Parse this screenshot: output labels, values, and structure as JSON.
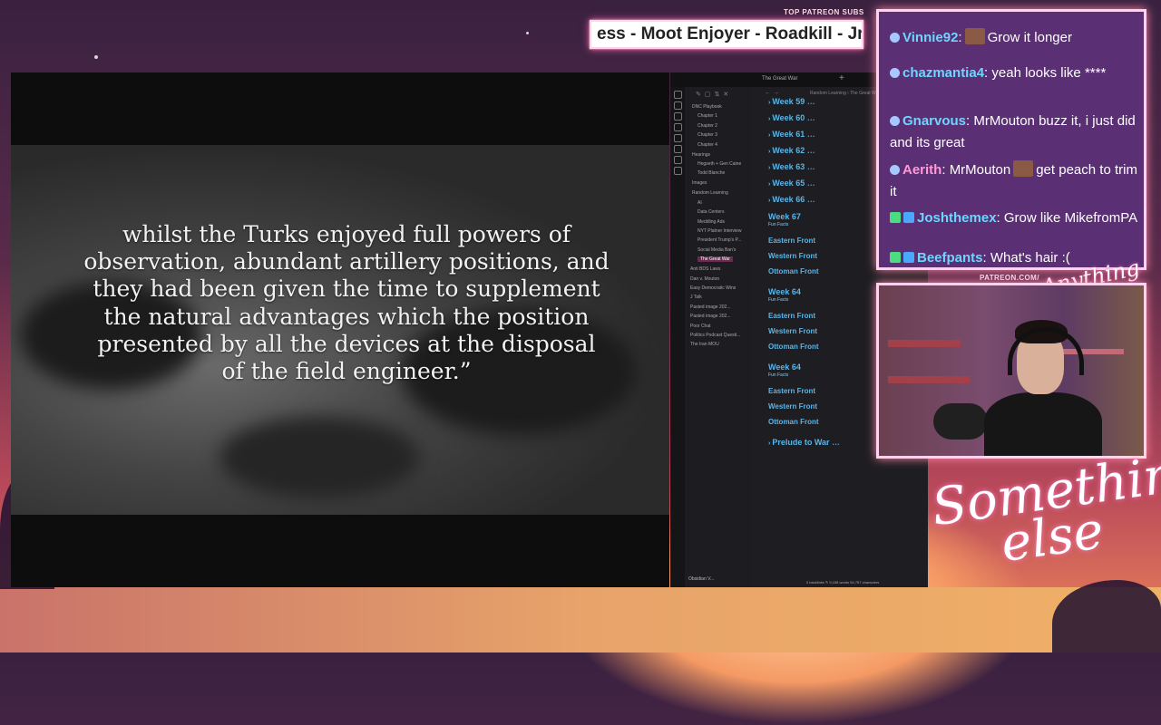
{
  "ticker": {
    "title": "TOP PATREON SUBS",
    "text": "ess - Moot Enjoyer - Roadkill - Jrb"
  },
  "video": {
    "quote": "whilst the Turks enjoyed full powers of observation, abundant artillery positions, and they had been given the time to supplement the natural advantages which the position presented by all the devices at the disposal of the field engineer.”"
  },
  "obsidian": {
    "tab_title": "The Great War",
    "breadcrumb": "Random Learning  ›  The Great W",
    "vault_name": "Obsidian V...",
    "status": "0 backlinks   ✎  9,158 words  54,757 characters",
    "tree": [
      "DNC Playbook",
      "Chapter 1",
      "Chapter 2",
      "Chapter 3",
      "Chapter 4",
      "Hearings",
      "Hegseth + Gen Caine",
      "Todd Blanche",
      "Images",
      "Random Learning",
      "AI",
      "Data Centers",
      "Meddling Ads",
      "NYT Platner Interview",
      "President Trump's P...",
      "Social Media Ban's",
      "The Great War",
      "Anti BDS Laws",
      "Dan v. Mouton",
      "Easy Democratic Wins",
      "J Talk",
      "Pasted image 202...",
      "Pasted image 202...",
      "Poor Chat",
      "Politics Podcast Questi...",
      "The Iran MOU"
    ],
    "headings": [
      {
        "text": "Week 59",
        "type": "week"
      },
      {
        "text": "Week 60",
        "type": "week"
      },
      {
        "text": "Week 61",
        "type": "week"
      },
      {
        "text": "Week 62",
        "type": "week"
      },
      {
        "text": "Week 63",
        "type": "week"
      },
      {
        "text": "Week 65",
        "type": "week"
      },
      {
        "text": "Week 66",
        "type": "week"
      },
      {
        "text": "Week 67",
        "type": "open",
        "sub": "Fun Facts"
      },
      {
        "text": "Eastern Front",
        "type": "front"
      },
      {
        "text": "Western Front",
        "type": "front"
      },
      {
        "text": "Ottoman Front",
        "type": "front"
      },
      {
        "text": "Week 64",
        "type": "open",
        "sub": "Fun Facts"
      },
      {
        "text": "Eastern Front",
        "type": "front"
      },
      {
        "text": "Western Front",
        "type": "front"
      },
      {
        "text": "Ottoman Front",
        "type": "front"
      },
      {
        "text": "Week 64",
        "type": "open",
        "sub": "Fun Facts"
      },
      {
        "text": "Eastern Front",
        "type": "front"
      },
      {
        "text": "Western Front",
        "type": "front"
      },
      {
        "text": "Ottoman Front",
        "type": "front"
      },
      {
        "text": "Prelude to War",
        "type": "week"
      }
    ]
  },
  "chat": {
    "messages": [
      {
        "user": "Vinnie92",
        "text": "Grow it longer",
        "emote": true
      },
      {
        "user": "chazmantia4",
        "text": "yeah looks like ****"
      },
      {
        "user": "Gnarvous",
        "text": "MrMouton buzz it, i just did and its great"
      },
      {
        "user": "Aerith",
        "text": "MrMouton",
        "text2": "get peach to trim it",
        "emote": true
      },
      {
        "user": "Joshthemex",
        "text": "Grow like MikefromPA",
        "badges": true
      },
      {
        "user": "Beefpants",
        "text": "What's hair :(",
        "badges": true
      }
    ]
  },
  "overlay": {
    "patreon_url": "PATREON.COM/",
    "logo_small": "Anything else",
    "logo_big_line1": "Something",
    "logo_big_line2": "else"
  },
  "colors": {
    "accent_pink": "#ffd3ef",
    "heading_blue": "#5ab4e6",
    "chat_bg": "#5a2f74"
  }
}
